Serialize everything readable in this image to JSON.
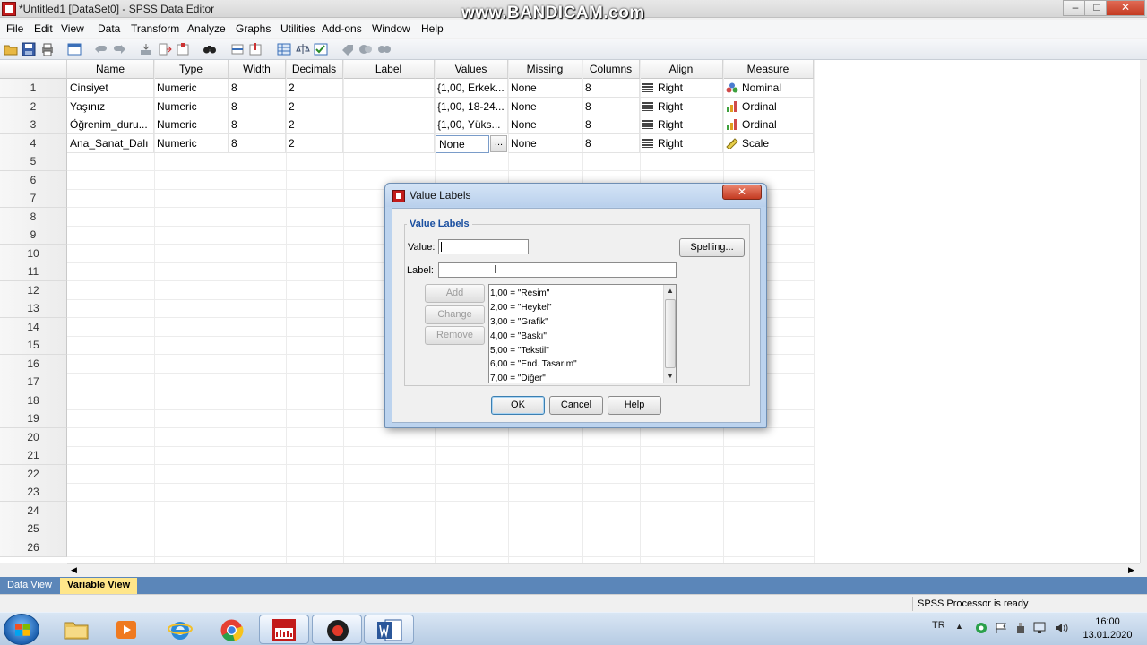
{
  "window": {
    "title": "*Untitled1 [DataSet0] - SPSS Data Editor",
    "watermark": "www.BANDICAM.com",
    "min": "–",
    "max": "□",
    "close": "✕"
  },
  "menu": [
    "File",
    "Edit",
    "View",
    "Data",
    "Transform",
    "Analyze",
    "Graphs",
    "Utilities",
    "Add-ons",
    "Window",
    "Help"
  ],
  "grid": {
    "headers": [
      "Name",
      "Type",
      "Width",
      "Decimals",
      "Label",
      "Values",
      "Missing",
      "Columns",
      "Align",
      "Measure"
    ],
    "row_numbers": [
      "1",
      "2",
      "3",
      "4",
      "5",
      "6",
      "7",
      "8",
      "9",
      "10",
      "11",
      "12",
      "13",
      "14",
      "15",
      "16",
      "17",
      "18",
      "19",
      "20",
      "21",
      "22",
      "23",
      "24",
      "25",
      "26"
    ],
    "rows": [
      {
        "name": "Cinsiyet",
        "type": "Numeric",
        "width": "8",
        "decimals": "2",
        "label": "",
        "values": "{1,00, Erkek...",
        "missing": "None",
        "columns": "8",
        "align": "Right",
        "measure": "Nominal",
        "measure_icon": "nominal-icon"
      },
      {
        "name": "Yaşınız",
        "type": "Numeric",
        "width": "8",
        "decimals": "2",
        "label": "",
        "values": "{1,00, 18-24...",
        "missing": "None",
        "columns": "8",
        "align": "Right",
        "measure": "Ordinal",
        "measure_icon": "ordinal-icon"
      },
      {
        "name": "Öğrenim_duru...",
        "type": "Numeric",
        "width": "8",
        "decimals": "2",
        "label": "",
        "values": "{1,00, Yüks...",
        "missing": "None",
        "columns": "8",
        "align": "Right",
        "measure": "Ordinal",
        "measure_icon": "ordinal-icon"
      },
      {
        "name": "Ana_Sanat_Dalı",
        "type": "Numeric",
        "width": "8",
        "decimals": "2",
        "label": "",
        "values": "None",
        "missing": "None",
        "columns": "8",
        "align": "Right",
        "measure": "Scale",
        "measure_icon": "scale-icon"
      }
    ],
    "values_button": "..."
  },
  "tabs": {
    "data_view": "Data View",
    "variable_view": "Variable View"
  },
  "status": {
    "processor": "SPSS  Processor is ready"
  },
  "taskbar": {
    "lang": "TR",
    "time": "16:00",
    "date": "13.01.2020"
  },
  "dialog": {
    "title": "Value Labels",
    "group_title": "Value Labels",
    "value_label": "Value:",
    "label_label": "Label:",
    "value_input": "",
    "label_input": "",
    "spelling": "Spelling...",
    "add": "Add",
    "change": "Change",
    "remove": "Remove",
    "list": [
      "1,00 = \"Resim\"",
      "2,00 = \"Heykel\"",
      "3,00 = \"Grafik\"",
      "4,00 = \"Baskı\"",
      "5,00 = \"Tekstil\"",
      "6,00 = \"End. Tasarım\"",
      "7,00 = \"Diğer\""
    ],
    "ok": "OK",
    "cancel": "Cancel",
    "help": "Help",
    "close": "✕"
  }
}
